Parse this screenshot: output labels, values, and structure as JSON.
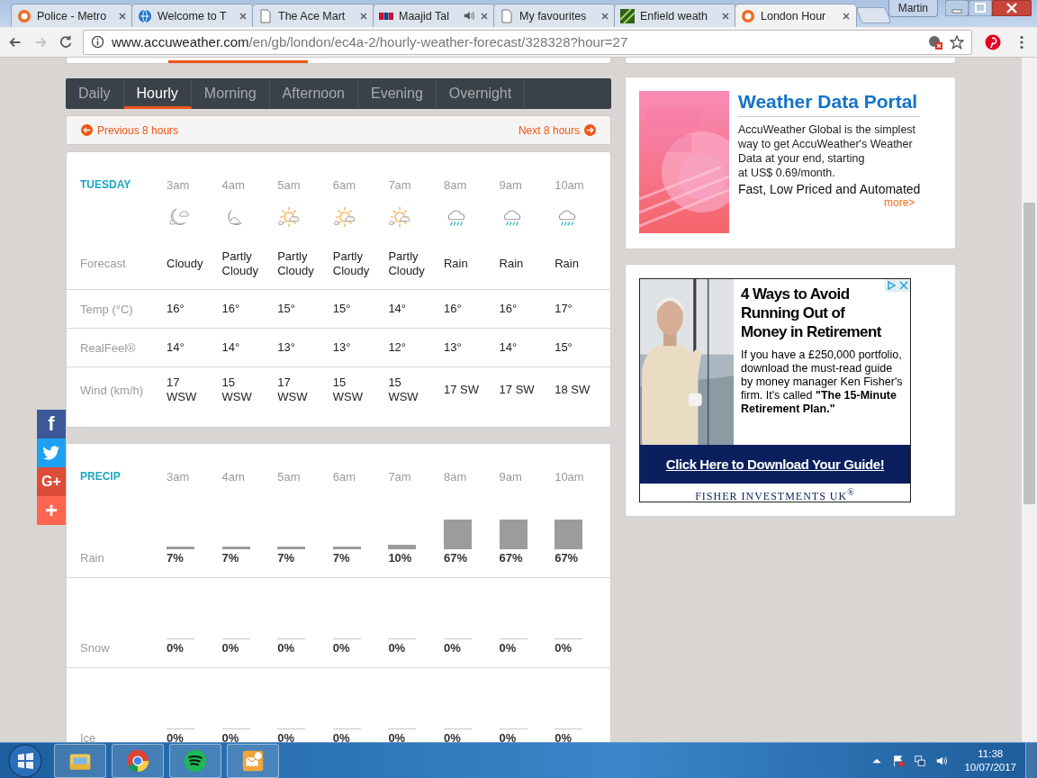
{
  "browser": {
    "tabs": [
      {
        "title": "Police - Metro",
        "kind": "sun",
        "selected": false,
        "audio": false
      },
      {
        "title": "Welcome to T",
        "kind": "globe",
        "selected": false,
        "audio": false
      },
      {
        "title": "The Ace Mart",
        "kind": "page",
        "selected": false,
        "audio": false
      },
      {
        "title": "Maajid Tal",
        "kind": "radio",
        "selected": false,
        "audio": true
      },
      {
        "title": "My favourites",
        "kind": "page",
        "selected": false,
        "audio": false
      },
      {
        "title": "Enfield weath",
        "kind": "stripes",
        "selected": false,
        "audio": false
      },
      {
        "title": "London Hour",
        "kind": "sun",
        "selected": true,
        "audio": false
      }
    ],
    "profile": "Martin",
    "nav_buttons": [
      {
        "kind": "back",
        "disabled": false
      },
      {
        "kind": "forward",
        "disabled": true
      },
      {
        "kind": "reload",
        "disabled": false
      }
    ],
    "url_host": "www.accuweather.com",
    "url_path": "/en/gb/london/ec4a-2/hourly-weather-forecast/328328?hour=27"
  },
  "social": [
    {
      "kind": "facebook",
      "glyph": "f",
      "color": "#3b5998"
    },
    {
      "kind": "twitter",
      "color": "#1da1f2"
    },
    {
      "kind": "googleplus",
      "glyph": "G+",
      "color": "#dd4b39"
    },
    {
      "kind": "share",
      "glyph": "+",
      "color": "#ff6550"
    }
  ],
  "view_tabs": [
    {
      "label": "Daily",
      "selected": false
    },
    {
      "label": "Hourly",
      "selected": true
    },
    {
      "label": "Morning",
      "selected": false
    },
    {
      "label": "Afternoon",
      "selected": false
    },
    {
      "label": "Evening",
      "selected": false
    },
    {
      "label": "Overnight",
      "selected": false
    }
  ],
  "nav": {
    "previous": "Previous 8 hours",
    "next": "Next 8 hours"
  },
  "forecast": {
    "day": "TUESDAY",
    "labels": {
      "forecast": "Forecast",
      "temp": "Temp (°C)",
      "realfeel": "RealFeel®",
      "wind": "Wind (km/h)"
    },
    "hours": [
      {
        "time": "3am",
        "kind": "moon-cloud",
        "forecast": "Cloudy",
        "temp": "16°",
        "realfeel": "14°",
        "wind": "17 WSW"
      },
      {
        "time": "4am",
        "kind": "moon",
        "forecast": "Partly Cloudy",
        "temp": "16°",
        "realfeel": "14°",
        "wind": "15 WSW"
      },
      {
        "time": "5am",
        "kind": "sun-cloud",
        "forecast": "Partly Cloudy",
        "temp": "15°",
        "realfeel": "13°",
        "wind": "17 WSW"
      },
      {
        "time": "6am",
        "kind": "sun-cloud",
        "forecast": "Partly Cloudy",
        "temp": "15°",
        "realfeel": "13°",
        "wind": "15 WSW"
      },
      {
        "time": "7am",
        "kind": "sun-cloud",
        "forecast": "Partly Cloudy",
        "temp": "14°",
        "realfeel": "12°",
        "wind": "15 WSW"
      },
      {
        "time": "8am",
        "kind": "rain",
        "forecast": "Rain",
        "temp": "16°",
        "realfeel": "13°",
        "wind": "17 SW"
      },
      {
        "time": "9am",
        "kind": "rain",
        "forecast": "Rain",
        "temp": "16°",
        "realfeel": "14°",
        "wind": "17 SW"
      },
      {
        "time": "10am",
        "kind": "rain",
        "forecast": "Rain",
        "temp": "17°",
        "realfeel": "15°",
        "wind": "18 SW"
      }
    ]
  },
  "precip": {
    "title": "PRECIP",
    "times": [
      "3am",
      "4am",
      "5am",
      "6am",
      "7am",
      "8am",
      "9am",
      "10am"
    ],
    "rows": [
      {
        "label": "Rain",
        "values": [
          "7%",
          "7%",
          "7%",
          "7%",
          "10%",
          "67%",
          "67%",
          "67%"
        ]
      },
      {
        "label": "Snow",
        "values": [
          "0%",
          "0%",
          "0%",
          "0%",
          "0%",
          "0%",
          "0%",
          "0%"
        ]
      },
      {
        "label": "Ice",
        "values": [
          "0%",
          "0%",
          "0%",
          "0%",
          "0%",
          "0%",
          "0%",
          "0%"
        ]
      }
    ]
  },
  "ad_portal": {
    "title": "Weather Data Portal",
    "body": "AccuWeather Global is the simplest\nway to get AccuWeather's Weather\nData at your end, starting\nat US$ 0.69/month.",
    "tagline": "Fast, Low Priced and Automated",
    "link": "more>"
  },
  "ad_fisher": {
    "headline": "4 Ways to Avoid Running Out of Money in Retirement",
    "body": "If you have a £250,000 portfolio, download the must-read guide by money manager Ken Fisher's firm. It's called **\"The 15-Minute Retirement Plan.\"**",
    "cta": "Click Here to Download Your Guide!",
    "brand": "FISHER INVESTMENTS UK$^{®}$"
  },
  "taskbar": {
    "apps": [
      {
        "kind": "explorer"
      },
      {
        "kind": "chrome"
      },
      {
        "kind": "spotify"
      },
      {
        "kind": "outlook"
      }
    ],
    "time": "11:38",
    "date": "10/07/2017"
  }
}
